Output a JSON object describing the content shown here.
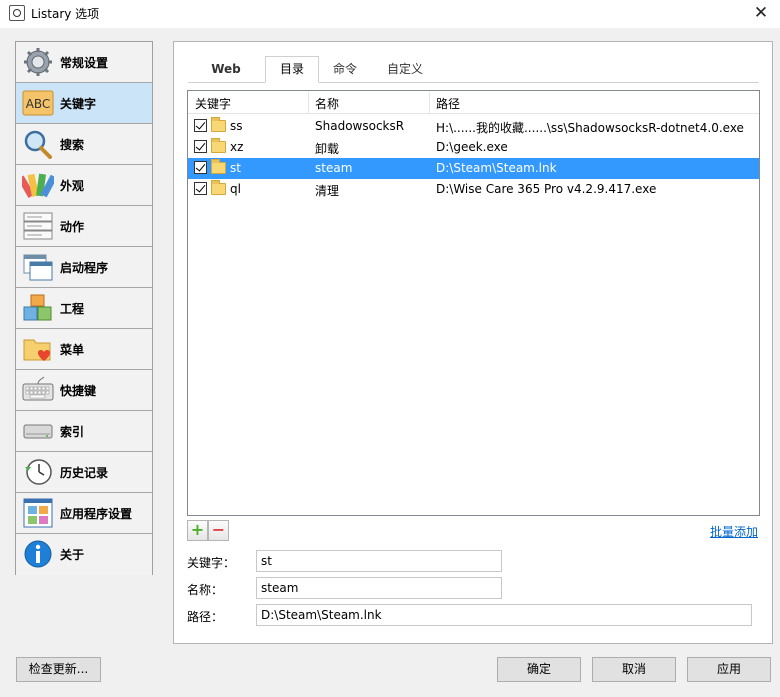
{
  "window": {
    "title": "Listary 选项"
  },
  "sidebar": {
    "items": [
      {
        "label": "常规设置",
        "icon": "gear-icon"
      },
      {
        "label": "关键字",
        "icon": "abc-keyword-icon"
      },
      {
        "label": "搜索",
        "icon": "magnifier-icon"
      },
      {
        "label": "外观",
        "icon": "palette-icon"
      },
      {
        "label": "动作",
        "icon": "actions-icon"
      },
      {
        "label": "启动程序",
        "icon": "launcher-icon"
      },
      {
        "label": "工程",
        "icon": "project-boxes-icon"
      },
      {
        "label": "菜单",
        "icon": "menu-folder-heart-icon"
      },
      {
        "label": "快捷键",
        "icon": "keyboard-icon"
      },
      {
        "label": "索引",
        "icon": "drive-icon"
      },
      {
        "label": "历史记录",
        "icon": "clock-icon"
      },
      {
        "label": "应用程序设置",
        "icon": "app-settings-icon"
      },
      {
        "label": "关于",
        "icon": "info-icon"
      }
    ],
    "active_index": 1
  },
  "tabs": [
    {
      "label": "Web"
    },
    {
      "label": "目录"
    },
    {
      "label": "命令"
    },
    {
      "label": "自定义"
    }
  ],
  "active_tab": "目录",
  "list": {
    "headers": {
      "keyword": "关键字",
      "name": "名称",
      "path": "路径"
    },
    "rows": [
      {
        "keyword": "ss",
        "name": "ShadowsocksR",
        "path": "H:\\......我的收藏......\\ss\\ShadowsocksR-dotnet4.0.exe",
        "checked": true
      },
      {
        "keyword": "xz",
        "name": "卸载",
        "path": "D:\\geek.exe",
        "checked": true
      },
      {
        "keyword": "st",
        "name": "steam",
        "path": "D:\\Steam\\Steam.lnk",
        "checked": true
      },
      {
        "keyword": "ql",
        "name": "清理",
        "path": "D:\\Wise Care 365 Pro v4.2.9.417.exe",
        "checked": true
      }
    ],
    "selected_index": 2
  },
  "controls": {
    "add": "+",
    "remove": "−",
    "batch_add": "批量添加"
  },
  "form": {
    "keyword_label": "关键字：",
    "keyword_value": "st",
    "name_label": "名称：",
    "name_value": "steam",
    "path_label": "路径：",
    "path_value": "D:\\Steam\\Steam.lnk"
  },
  "buttons": {
    "check_updates": "检查更新...",
    "ok": "确定",
    "cancel": "取消",
    "apply": "应用"
  },
  "colors": {
    "selection": "#3399ff",
    "sidebar_active": "#cce4f7",
    "link": "#0066cc"
  }
}
